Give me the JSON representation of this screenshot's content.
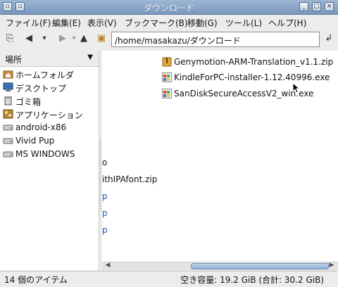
{
  "window": {
    "title": "ダウンロード"
  },
  "menubar": {
    "items": [
      "ファイル(F)",
      "編集(E)",
      "表示(V)",
      "ブックマーク(B)",
      "移動(G)",
      "ツール(L)",
      "ヘルプ(H)"
    ]
  },
  "toolbar": {
    "path": "/home/masakazu/ダウンロード"
  },
  "sidebar": {
    "header": "場所",
    "items": [
      {
        "label": "ホームフォルダ",
        "icon": "home-folder-icon"
      },
      {
        "label": "デスクトップ",
        "icon": "desktop-icon"
      },
      {
        "label": "ゴミ箱",
        "icon": "trash-icon"
      },
      {
        "label": "アプリケーション",
        "icon": "applications-icon"
      },
      {
        "label": "android-x86",
        "icon": "drive-icon"
      },
      {
        "label": "Vivid Pup",
        "icon": "drive-icon"
      },
      {
        "label": "MS WINDOWS",
        "icon": "drive-icon"
      }
    ]
  },
  "files": [
    {
      "name": "Genymotion-ARM-Translation_v1.1.zip",
      "icon": "zip-archive-icon"
    },
    {
      "name": "KindleForPC-installer-1.12.40996.exe",
      "icon": "windows-exe-icon"
    },
    {
      "name": "SanDiskSecureAccessV2_win.exe",
      "icon": "windows-exe-icon"
    }
  ],
  "left_fragments": [
    "o",
    "ithIPAfont.zip",
    "p",
    "p",
    "p"
  ],
  "status": {
    "items": "14 個のアイテム",
    "free_space": "空き容量: 19.2 GiB (合計: 30.2 GiB)"
  },
  "colors": {
    "titlebar": "#8aa6c8",
    "scroll_thumb": "#a6c1e0"
  }
}
